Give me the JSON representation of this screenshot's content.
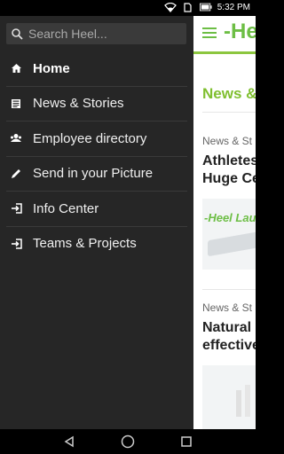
{
  "status_bar": {
    "time": "5:32 PM"
  },
  "drawer": {
    "search_placeholder": "Search Heel...",
    "items": [
      {
        "label": "Home",
        "icon": "home-icon",
        "active": true
      },
      {
        "label": "News & Stories",
        "icon": "newspaper-icon"
      },
      {
        "label": "Employee directory",
        "icon": "people-icon"
      },
      {
        "label": "Send in your Picture",
        "icon": "pencil-icon"
      },
      {
        "label": "Info Center",
        "icon": "sign-in-icon"
      },
      {
        "label": "Teams & Projects",
        "icon": "sign-in-icon"
      }
    ]
  },
  "content": {
    "logo": "-Heel",
    "section_title": "News &",
    "articles": [
      {
        "category": "News & St",
        "headline_1": "Athletes",
        "headline_2": "Huge Ce",
        "thumb_text": "-Heel Lauf"
      },
      {
        "category": "News & St",
        "headline_1": "Natural",
        "headline_2": "effective"
      }
    ]
  },
  "colors": {
    "accent": "#6dbe45",
    "drawer_bg": "#262626"
  }
}
